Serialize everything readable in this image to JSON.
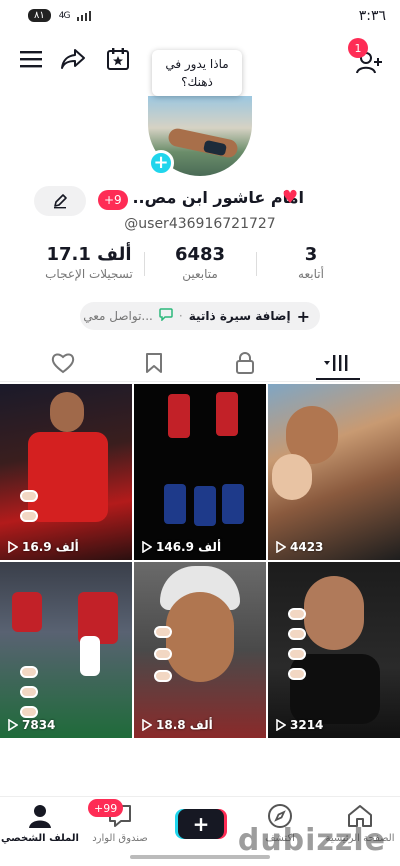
{
  "status_bar": {
    "time": "٣:٣٦",
    "battery": "٨١",
    "network": "4G"
  },
  "tooltip": {
    "text": "ماذا يدور في ذهنك؟"
  },
  "notifications": {
    "count": "1"
  },
  "profile": {
    "display_name": "امام عاشور ابن مص...",
    "badge": "+9",
    "username": "@user436916721727",
    "heart": "♥"
  },
  "stats": {
    "following": {
      "value": "3",
      "label": "أتابعه"
    },
    "followers": {
      "value": "6483",
      "label": "متابعين"
    },
    "likes": {
      "value": "17.1 ألف",
      "label": "تسجيلات الإعجاب"
    }
  },
  "bio": {
    "add_label": "إضافة سيرة ذاتية",
    "dot": "·",
    "contact_label": "تواصل معي..."
  },
  "videos": [
    {
      "views": "4423"
    },
    {
      "views": "146.9 ألف"
    },
    {
      "views": "16.9 ألف"
    },
    {
      "views": "3214"
    },
    {
      "views": "18.8 ألف"
    },
    {
      "views": "7834"
    }
  ],
  "bottom_nav": {
    "home": "الصفحة الرئيسية",
    "discover": "اكتشف",
    "inbox": "صندوق الوارد",
    "inbox_badge": "+99",
    "profile": "الملف الشخصي"
  },
  "watermark": "dubizzle",
  "colors": {
    "accent_red": "#fe2c55",
    "accent_cyan": "#20d5ec",
    "text_dark": "#161823"
  }
}
